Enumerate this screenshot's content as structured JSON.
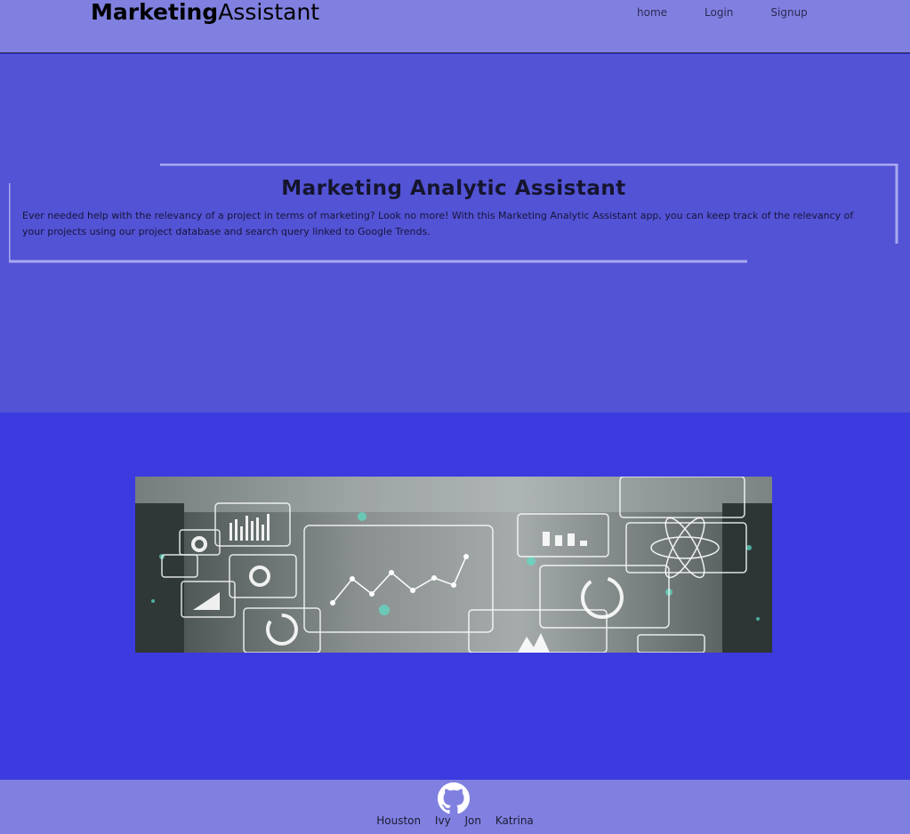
{
  "navbar": {
    "brand_bold": "Marketing",
    "brand_light": "Assistant",
    "links": [
      {
        "label": "home"
      },
      {
        "label": "Login"
      },
      {
        "label": "Signup"
      }
    ]
  },
  "hero": {
    "title": "Marketing Analytic Assistant",
    "description": "Ever needed help with the relevancy of a project in terms of marketing? Look no more! With this Marketing Analytic Assistant app, you can keep track of the relevancy of your projects using our project database and search query linked to Google Trends."
  },
  "banner": {
    "image": "analytics-dashboard-hologram-image"
  },
  "footer": {
    "icon": "github-icon",
    "links": [
      {
        "label": "Houston"
      },
      {
        "label": "Ivy"
      },
      {
        "label": "Jon"
      },
      {
        "label": "Katrina"
      }
    ]
  },
  "colors": {
    "navbar_bg": "#8080e0",
    "hero_bg": "#5353d6",
    "content_bg": "#3b3bdf",
    "footer_bg": "#8080e0"
  }
}
